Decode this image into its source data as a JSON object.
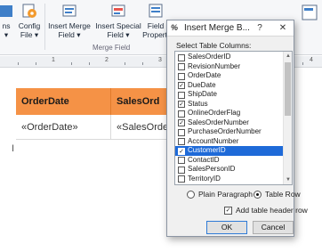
{
  "ribbon": {
    "buttons": [
      {
        "label1": "ns",
        "label2": "▾",
        "icon": "partial-icon"
      },
      {
        "label1": "Config",
        "label2": "File ▾",
        "icon": "config-file-icon"
      },
      {
        "label1": "Insert Merge",
        "label2": "Field ▾",
        "icon": "insert-merge-field-icon"
      },
      {
        "label1": "Insert Special",
        "label2": "Field ▾",
        "icon": "insert-special-field-icon"
      },
      {
        "label1": "Field",
        "label2": "Properti",
        "icon": "field-properties-icon"
      }
    ],
    "group_label": "Merge Field"
  },
  "ruler": {
    "numbers": [
      "1",
      "2",
      "3",
      "4"
    ]
  },
  "document": {
    "headers": [
      "OrderDate",
      "SalesOrd"
    ],
    "cells": [
      "«OrderDate»",
      "«SalesOrde"
    ]
  },
  "dialog": {
    "title": "Insert Merge B...",
    "help_glyph": "?",
    "close_glyph": "✕",
    "select_label": "Select Table Columns:",
    "columns": [
      {
        "name": "SalesOrderID",
        "checked": false,
        "selected": false
      },
      {
        "name": "RevisionNumber",
        "checked": false,
        "selected": false
      },
      {
        "name": "OrderDate",
        "checked": false,
        "selected": false
      },
      {
        "name": "DueDate",
        "checked": true,
        "selected": false
      },
      {
        "name": "ShipDate",
        "checked": false,
        "selected": false
      },
      {
        "name": "Status",
        "checked": true,
        "selected": false
      },
      {
        "name": "OnlineOrderFlag",
        "checked": false,
        "selected": false
      },
      {
        "name": "SalesOrderNumber",
        "checked": true,
        "selected": false
      },
      {
        "name": "PurchaseOrderNumber",
        "checked": false,
        "selected": false
      },
      {
        "name": "AccountNumber",
        "checked": false,
        "selected": false
      },
      {
        "name": "CustomerID",
        "checked": true,
        "selected": true
      },
      {
        "name": "ContactID",
        "checked": false,
        "selected": false
      },
      {
        "name": "SalesPersonID",
        "checked": false,
        "selected": false
      },
      {
        "name": "TerritoryID",
        "checked": false,
        "selected": false
      }
    ],
    "radio_plain": "Plain Paragraph",
    "radio_table": "Table Row",
    "radio_selected": "Table Row",
    "add_header_label": "Add table header row",
    "add_header_checked": true,
    "ok_label": "OK",
    "cancel_label": "Cancel",
    "colors": {
      "selection": "#1e6ad8",
      "header_fill": "#f59246"
    }
  }
}
